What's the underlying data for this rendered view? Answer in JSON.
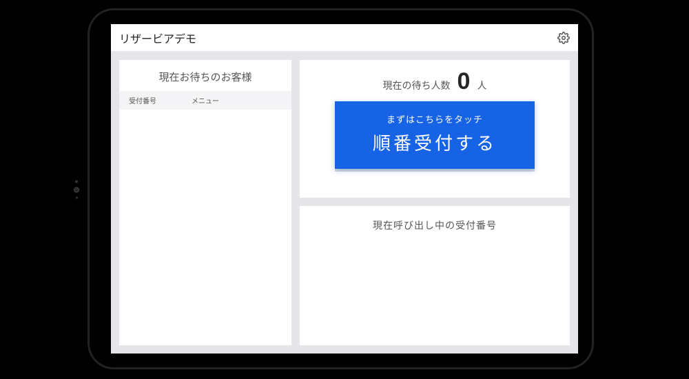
{
  "header": {
    "title": "リザービアデモ"
  },
  "waiting": {
    "title": "現在お待ちのお客様",
    "columns": {
      "number": "受付番号",
      "menu": "メニュー"
    }
  },
  "counter": {
    "label": "現在の待ち人数",
    "value": "0",
    "unit": "人"
  },
  "cta": {
    "hint": "まずはこちらをタッチ",
    "main": "順番受付する"
  },
  "calling": {
    "title": "現在呼び出し中の受付番号"
  }
}
